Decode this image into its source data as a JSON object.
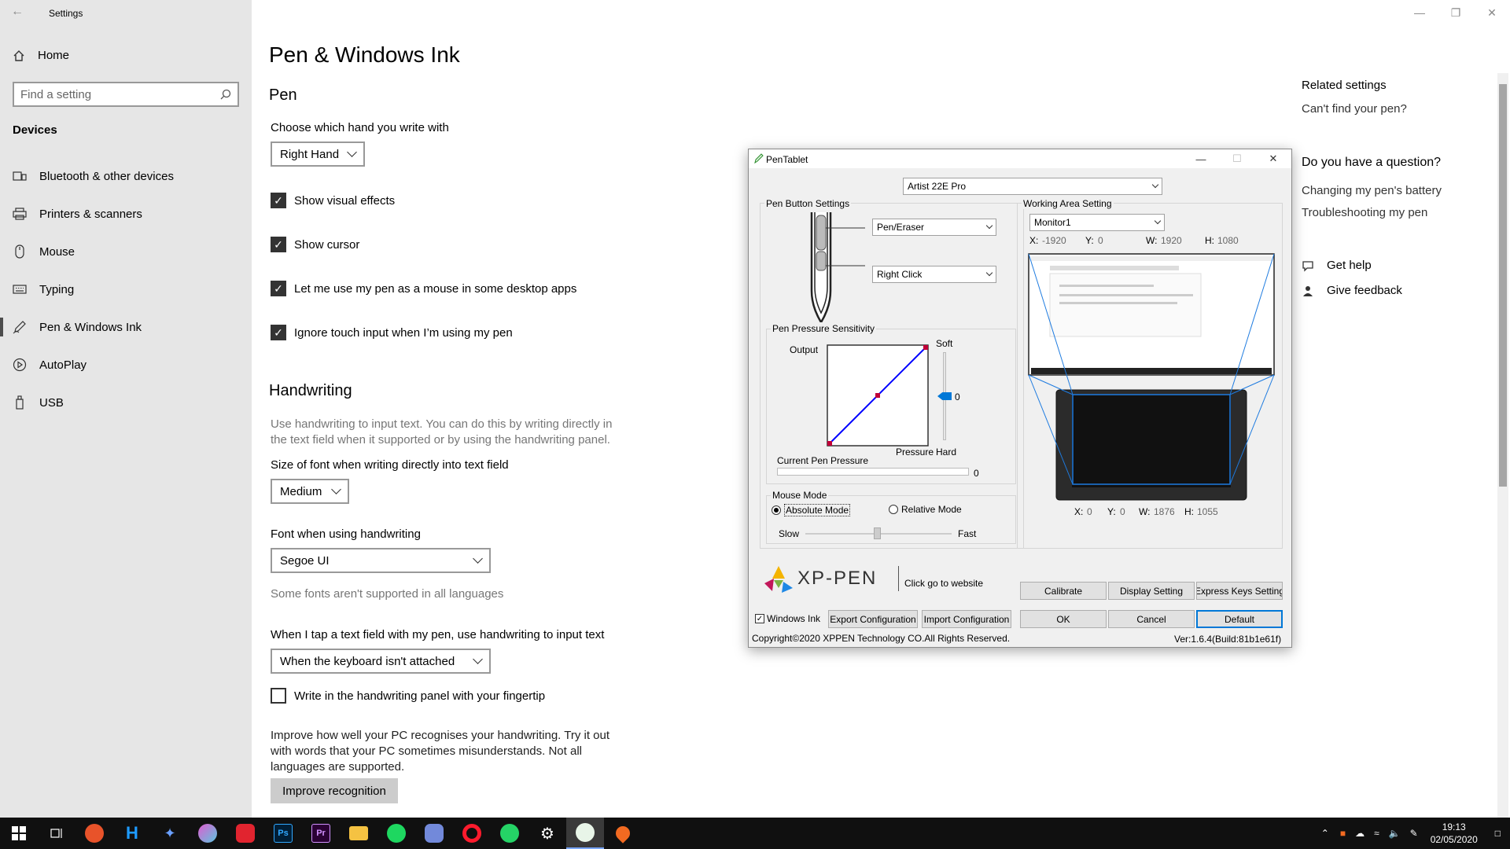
{
  "settings": {
    "app_title": "Settings",
    "home_label": "Home",
    "search_placeholder": "Find a setting",
    "section_label": "Devices",
    "nav": [
      {
        "label": "Bluetooth & other devices"
      },
      {
        "label": "Printers & scanners"
      },
      {
        "label": "Mouse"
      },
      {
        "label": "Typing"
      },
      {
        "label": "Pen & Windows Ink",
        "active": true
      },
      {
        "label": "AutoPlay"
      },
      {
        "label": "USB"
      }
    ],
    "page_title": "Pen & Windows Ink",
    "pen_heading": "Pen",
    "hand_label": "Choose which hand you write with",
    "hand_value": "Right Hand",
    "checkboxes": [
      {
        "label": "Show visual effects",
        "checked": true
      },
      {
        "label": "Show cursor",
        "checked": true
      },
      {
        "label": "Let me use my pen as a mouse in some desktop apps",
        "checked": true
      },
      {
        "label": "Ignore touch input when I’m using my pen",
        "checked": true
      }
    ],
    "handwriting_heading": "Handwriting",
    "handwriting_desc": "Use handwriting to input text. You can do this by writing directly in the text field when it supported or by using the handwriting panel.",
    "font_size_label": "Size of font when writing directly into text field",
    "font_size_value": "Medium",
    "font_label": "Font when using handwriting",
    "font_value": "Segoe UI",
    "font_note": "Some fonts aren't supported in all languages",
    "tap_label": "When I tap a text field with my pen, use handwriting to input text",
    "tap_value": "When the keyboard isn't attached",
    "finger_label": "Write in the handwriting panel with your fingertip",
    "finger_checked": false,
    "improve_desc": "Improve how well your PC recognises your handwriting. Try it out with words that your PC sometimes misunderstands. Not all languages are supported.",
    "improve_button": "Improve recognition",
    "related": {
      "title": "Related settings",
      "link1": "Can't find your pen?",
      "question_title": "Do you have a question?",
      "link2": "Changing my pen's battery",
      "link3": "Troubleshooting my pen",
      "help": "Get help",
      "feedback": "Give feedback"
    }
  },
  "pentablet": {
    "title": "PenTablet",
    "device": "Artist 22E Pro",
    "pen_button_settings": "Pen Button Settings",
    "button1": "Pen/Eraser",
    "button2": "Right Click",
    "pressure_group": "Pen Pressure Sensitivity",
    "output_label": "Output",
    "pressure_label": "Pressure",
    "soft_label": "Soft",
    "hard_label": "Hard",
    "sensitivity_value": "0",
    "current_pressure_label": "Current Pen Pressure",
    "current_pressure_value": "0",
    "mouse_mode_group": "Mouse Mode",
    "absolute_mode": "Absolute Mode",
    "relative_mode": "Relative Mode",
    "mouse_mode_selected": "Absolute Mode",
    "slow_label": "Slow",
    "fast_label": "Fast",
    "working_area_group": "Working Area Setting",
    "monitor": "Monitor1",
    "screen_area": {
      "x_label": "X:",
      "x": "-1920",
      "y_label": "Y:",
      "y": "0",
      "w_label": "W:",
      "w": "1920",
      "h_label": "H:",
      "h": "1080"
    },
    "tablet_area": {
      "x_label": "X:",
      "x": "0",
      "y_label": "Y:",
      "y": "0",
      "w_label": "W:",
      "w": "1876",
      "h_label": "H:",
      "h": "1055"
    },
    "brand": "XP-PEN",
    "website_link": "Click go to website",
    "calibrate": "Calibrate",
    "display_setting": "Display Setting",
    "express_keys": "Express Keys Setting",
    "windows_ink": "Windows Ink",
    "windows_ink_checked": true,
    "export_config": "Export Configuration",
    "import_config": "Import Configuration",
    "ok": "OK",
    "cancel": "Cancel",
    "default": "Default",
    "copyright": "Copyright©2020  XPPEN Technology CO.All Rights Reserved.",
    "version": "Ver:1.6.4(Build:81b1e61f)"
  },
  "taskbar": {
    "time": "19:13",
    "date": "02/05/2020",
    "apps": [
      "start-icon",
      "task-view-icon",
      "app-icon",
      "h-app-icon",
      "butterfly-icon",
      "orb-app-icon",
      "red-app-icon",
      "photoshop-icon",
      "premiere-icon",
      "file-explorer-icon",
      "spotify-icon",
      "discord-icon",
      "opera-icon",
      "whatsapp-icon",
      "settings-icon",
      "pentablet-icon",
      "maps-icon"
    ]
  },
  "colors": {
    "accent": "#0078d7",
    "sidebar_bg": "#e6e6e6",
    "taskbar_bg": "#101010",
    "curve": "#0000ff"
  }
}
